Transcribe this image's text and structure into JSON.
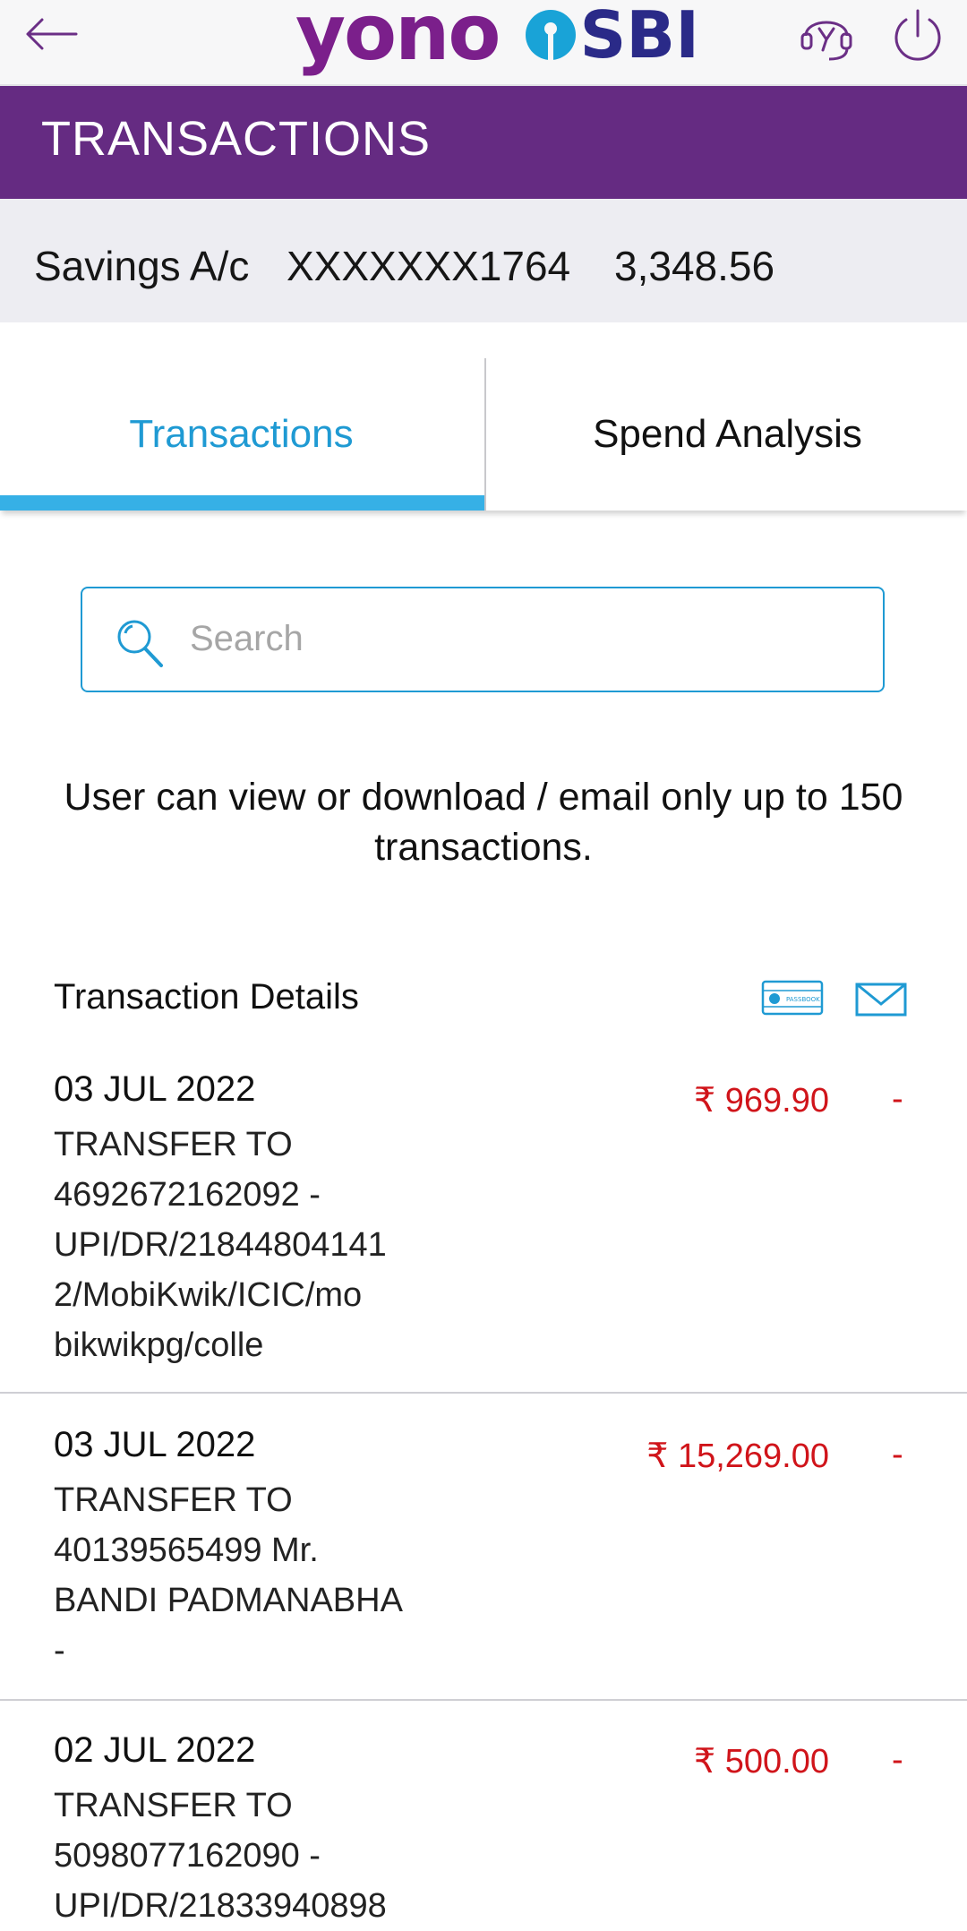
{
  "header": {
    "logo_yono": "yono",
    "logo_sbi": "SBI",
    "icons": [
      "back-arrow-icon",
      "help-headset-icon",
      "power-icon"
    ]
  },
  "title": "TRANSACTIONS",
  "account": {
    "type": "Savings A/c",
    "number": "XXXXXXX1764",
    "balance": "3,348.56"
  },
  "tabs": [
    {
      "label": "Transactions",
      "active": true
    },
    {
      "label": "Spend Analysis",
      "active": false
    }
  ],
  "search": {
    "placeholder": "Search"
  },
  "notice": "User can view or download / email only up to 150 transactions.",
  "details": {
    "title": "Transaction Details",
    "icons": [
      "passbook-icon",
      "email-icon"
    ],
    "passbook_text": "PASSBOOK"
  },
  "transactions": [
    {
      "date": "03 JUL 2022",
      "description": "TRANSFER TO\n4692672162092 -\nUPI/DR/21844804141\n2/MobiKwik/ICIC/mo\nbikwikpg/colle",
      "amount": "₹ 969.90",
      "sign": "-"
    },
    {
      "date": "03 JUL 2022",
      "description": "TRANSFER TO\n40139565499 Mr.\nBANDI PADMANABHA\n-",
      "amount": "₹ 15,269.00",
      "sign": "-"
    },
    {
      "date": "02 JUL 2022",
      "description": "TRANSFER TO\n5098077162090 -\nUPI/DR/21833940898",
      "amount": "₹ 500.00",
      "sign": "-"
    }
  ],
  "colors": {
    "brand_purple": "#652b82",
    "accent_blue": "#1f9ad3",
    "debit_red": "#d0141a"
  }
}
